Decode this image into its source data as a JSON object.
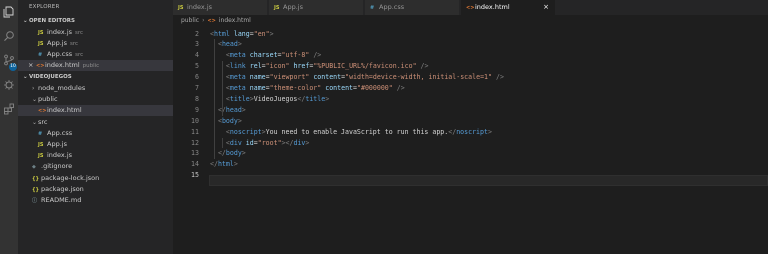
{
  "explorer": {
    "title": "EXPLORER",
    "open_editors_title": "OPEN EDITORS",
    "project_title": "VIDEOJUEGOS",
    "open_editors": [
      {
        "icon": "JS",
        "type": "js",
        "name": "index.js",
        "folder": "src"
      },
      {
        "icon": "JS",
        "type": "js",
        "name": "App.js",
        "folder": "src"
      },
      {
        "icon": "#",
        "type": "css",
        "name": "App.css",
        "folder": "src"
      },
      {
        "icon": "<>",
        "type": "html",
        "name": "index.html",
        "folder": "public"
      }
    ],
    "tree": [
      {
        "label": "node_modules",
        "kind": "folder-collapsed"
      },
      {
        "label": "public",
        "kind": "folder-open"
      },
      {
        "label": "index.html",
        "kind": "file",
        "icon": "<>",
        "type": "html"
      },
      {
        "label": "src",
        "kind": "folder-open"
      },
      {
        "label": "App.css",
        "kind": "file",
        "icon": "#",
        "type": "css"
      },
      {
        "label": "App.js",
        "kind": "file",
        "icon": "JS",
        "type": "js"
      },
      {
        "label": "index.js",
        "kind": "file",
        "icon": "JS",
        "type": "js"
      },
      {
        "label": ".gitignore",
        "kind": "file",
        "icon": "◆",
        "type": "git"
      },
      {
        "label": "package-lock.json",
        "kind": "file",
        "icon": "{}",
        "type": "json"
      },
      {
        "label": "package.json",
        "kind": "file",
        "icon": "{}",
        "type": "json"
      },
      {
        "label": "README.md",
        "kind": "file",
        "icon": "ⓘ",
        "type": "info"
      }
    ]
  },
  "activity": {
    "badge": "10"
  },
  "tabs": [
    {
      "icon": "JS",
      "type": "js",
      "label": "index.js"
    },
    {
      "icon": "JS",
      "type": "js",
      "label": "App.js"
    },
    {
      "icon": "#",
      "type": "css",
      "label": "App.css"
    },
    {
      "icon": "<>",
      "type": "html",
      "label": "index.html",
      "active": true,
      "close": "×"
    }
  ],
  "breadcrumb": {
    "folder": "public",
    "sep": "›",
    "file_icon": "<>",
    "file": "index.html"
  },
  "editor": {
    "current_line": 15,
    "lines": [
      {
        "n": "2",
        "segs": [
          [
            "p",
            "<"
          ],
          [
            "t",
            "html"
          ],
          [
            "x",
            " "
          ],
          [
            "a",
            "lang"
          ],
          [
            "x",
            "="
          ],
          [
            "s",
            "\"en\""
          ],
          [
            "p",
            ">"
          ]
        ]
      },
      {
        "n": "3",
        "segs": [
          [
            "x",
            "  "
          ],
          [
            "p",
            "<"
          ],
          [
            "t",
            "head"
          ],
          [
            "p",
            ">"
          ]
        ]
      },
      {
        "n": "4",
        "segs": [
          [
            "x",
            "    "
          ],
          [
            "p",
            "<"
          ],
          [
            "t",
            "meta"
          ],
          [
            "x",
            " "
          ],
          [
            "a",
            "charset"
          ],
          [
            "x",
            "="
          ],
          [
            "s",
            "\"utf-8\""
          ],
          [
            "x",
            " "
          ],
          [
            "p",
            "/>"
          ]
        ]
      },
      {
        "n": "5",
        "segs": [
          [
            "x",
            "    "
          ],
          [
            "p",
            "<"
          ],
          [
            "t",
            "link"
          ],
          [
            "x",
            " "
          ],
          [
            "a",
            "rel"
          ],
          [
            "x",
            "="
          ],
          [
            "s",
            "\"icon\""
          ],
          [
            "x",
            " "
          ],
          [
            "a",
            "href"
          ],
          [
            "x",
            "="
          ],
          [
            "s",
            "\"%PUBLIC_URL%/favicon.ico\""
          ],
          [
            "x",
            " "
          ],
          [
            "p",
            "/>"
          ]
        ]
      },
      {
        "n": "6",
        "segs": [
          [
            "x",
            "    "
          ],
          [
            "p",
            "<"
          ],
          [
            "t",
            "meta"
          ],
          [
            "x",
            " "
          ],
          [
            "a",
            "name"
          ],
          [
            "x",
            "="
          ],
          [
            "s",
            "\"viewport\""
          ],
          [
            "x",
            " "
          ],
          [
            "a",
            "content"
          ],
          [
            "x",
            "="
          ],
          [
            "s",
            "\"width=device-width, initial-scale=1\""
          ],
          [
            "x",
            " "
          ],
          [
            "p",
            "/>"
          ]
        ]
      },
      {
        "n": "7",
        "segs": [
          [
            "x",
            "    "
          ],
          [
            "p",
            "<"
          ],
          [
            "t",
            "meta"
          ],
          [
            "x",
            " "
          ],
          [
            "a",
            "name"
          ],
          [
            "x",
            "="
          ],
          [
            "s",
            "\"theme-color\""
          ],
          [
            "x",
            " "
          ],
          [
            "a",
            "content"
          ],
          [
            "x",
            "="
          ],
          [
            "s",
            "\"#000000\""
          ],
          [
            "x",
            " "
          ],
          [
            "p",
            "/>"
          ]
        ]
      },
      {
        "n": "8",
        "segs": [
          [
            "x",
            "    "
          ],
          [
            "p",
            "<"
          ],
          [
            "t",
            "title"
          ],
          [
            "p",
            ">"
          ],
          [
            "x",
            "VideoJuegos"
          ],
          [
            "p",
            "</"
          ],
          [
            "t",
            "title"
          ],
          [
            "p",
            ">"
          ]
        ]
      },
      {
        "n": "9",
        "segs": [
          [
            "x",
            "  "
          ],
          [
            "p",
            "</"
          ],
          [
            "t",
            "head"
          ],
          [
            "p",
            ">"
          ]
        ]
      },
      {
        "n": "10",
        "segs": [
          [
            "x",
            "  "
          ],
          [
            "p",
            "<"
          ],
          [
            "t",
            "body"
          ],
          [
            "p",
            ">"
          ]
        ]
      },
      {
        "n": "11",
        "segs": [
          [
            "x",
            "    "
          ],
          [
            "p",
            "<"
          ],
          [
            "t",
            "noscript"
          ],
          [
            "p",
            ">"
          ],
          [
            "x",
            "You need to enable JavaScript to run this app."
          ],
          [
            "p",
            "</"
          ],
          [
            "t",
            "noscript"
          ],
          [
            "p",
            ">"
          ]
        ]
      },
      {
        "n": "12",
        "segs": [
          [
            "x",
            "    "
          ],
          [
            "p",
            "<"
          ],
          [
            "t",
            "div"
          ],
          [
            "x",
            " "
          ],
          [
            "a",
            "id"
          ],
          [
            "x",
            "="
          ],
          [
            "s",
            "\"root\""
          ],
          [
            "p",
            "></"
          ],
          [
            "t",
            "div"
          ],
          [
            "p",
            ">"
          ]
        ]
      },
      {
        "n": "13",
        "segs": [
          [
            "x",
            "  "
          ],
          [
            "p",
            "</"
          ],
          [
            "t",
            "body"
          ],
          [
            "p",
            ">"
          ]
        ]
      },
      {
        "n": "14",
        "segs": [
          [
            "p",
            "</"
          ],
          [
            "t",
            "html"
          ],
          [
            "p",
            ">"
          ]
        ]
      },
      {
        "n": "15",
        "segs": []
      }
    ]
  }
}
